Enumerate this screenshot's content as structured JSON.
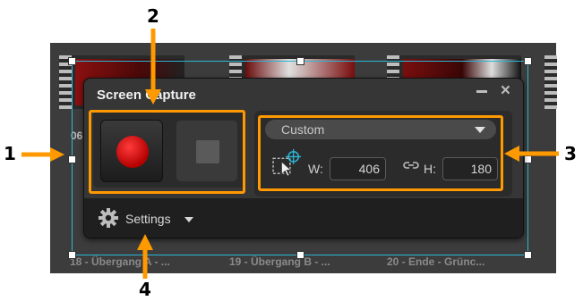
{
  "timeline": {
    "clips": [
      {
        "caption": "18 - Übergang A - ..."
      },
      {
        "caption": "19 - Übergang B - ..."
      },
      {
        "caption": "20 - Ende - Grünc..."
      }
    ],
    "side_caption": "06"
  },
  "capture_panel": {
    "title": "Screen Capture",
    "minimize_icon": "minimize-icon",
    "close_icon": "close-icon",
    "close_glyph": "×",
    "record_icon": "record-icon",
    "stop_icon": "stop-icon",
    "preset": {
      "selected": "Custom"
    },
    "width_label": "W:",
    "width_value": "406",
    "height_label": "H:",
    "height_value": "180",
    "settings_label": "Settings"
  },
  "callouts": [
    "1",
    "2",
    "3",
    "4"
  ],
  "colors": {
    "accent_orange": "#ff9900",
    "selection_frame": "#2ab7d6",
    "record_red": "#d10000",
    "panel_bg": "#363636"
  }
}
